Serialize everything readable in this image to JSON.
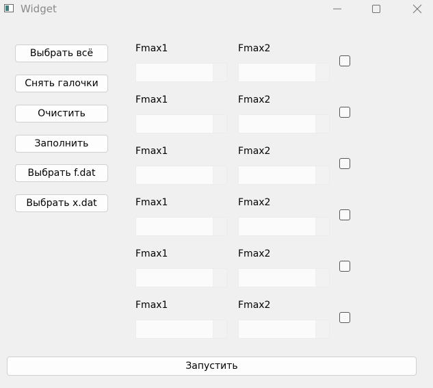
{
  "window": {
    "title": "Widget",
    "app_icon": "window-icon",
    "controls": [
      "minimize-icon",
      "maximize-icon",
      "close-icon"
    ]
  },
  "sidebar": {
    "buttons": [
      {
        "label": "Выбрать всё"
      },
      {
        "label": "Снять галочки"
      },
      {
        "label": "Очистить"
      },
      {
        "label": "Заполнить"
      },
      {
        "label": "Выбрать f.dat"
      },
      {
        "label": "Выбрать x.dat"
      }
    ]
  },
  "rows": [
    {
      "fmax1_label": "Fmax1",
      "fmax1_value": "",
      "fmax2_label": "Fmax2",
      "fmax2_value": "",
      "checked": false
    },
    {
      "fmax1_label": "Fmax1",
      "fmax1_value": "",
      "fmax2_label": "Fmax2",
      "fmax2_value": "",
      "checked": false
    },
    {
      "fmax1_label": "Fmax1",
      "fmax1_value": "",
      "fmax2_label": "Fmax2",
      "fmax2_value": "",
      "checked": false
    },
    {
      "fmax1_label": "Fmax1",
      "fmax1_value": "",
      "fmax2_label": "Fmax2",
      "fmax2_value": "",
      "checked": false
    },
    {
      "fmax1_label": "Fmax1",
      "fmax1_value": "",
      "fmax2_label": "Fmax2",
      "fmax2_value": "",
      "checked": false
    },
    {
      "fmax1_label": "Fmax1",
      "fmax1_value": "",
      "fmax2_label": "Fmax2",
      "fmax2_value": "",
      "checked": false
    }
  ],
  "footer": {
    "run_label": "Запустить"
  }
}
